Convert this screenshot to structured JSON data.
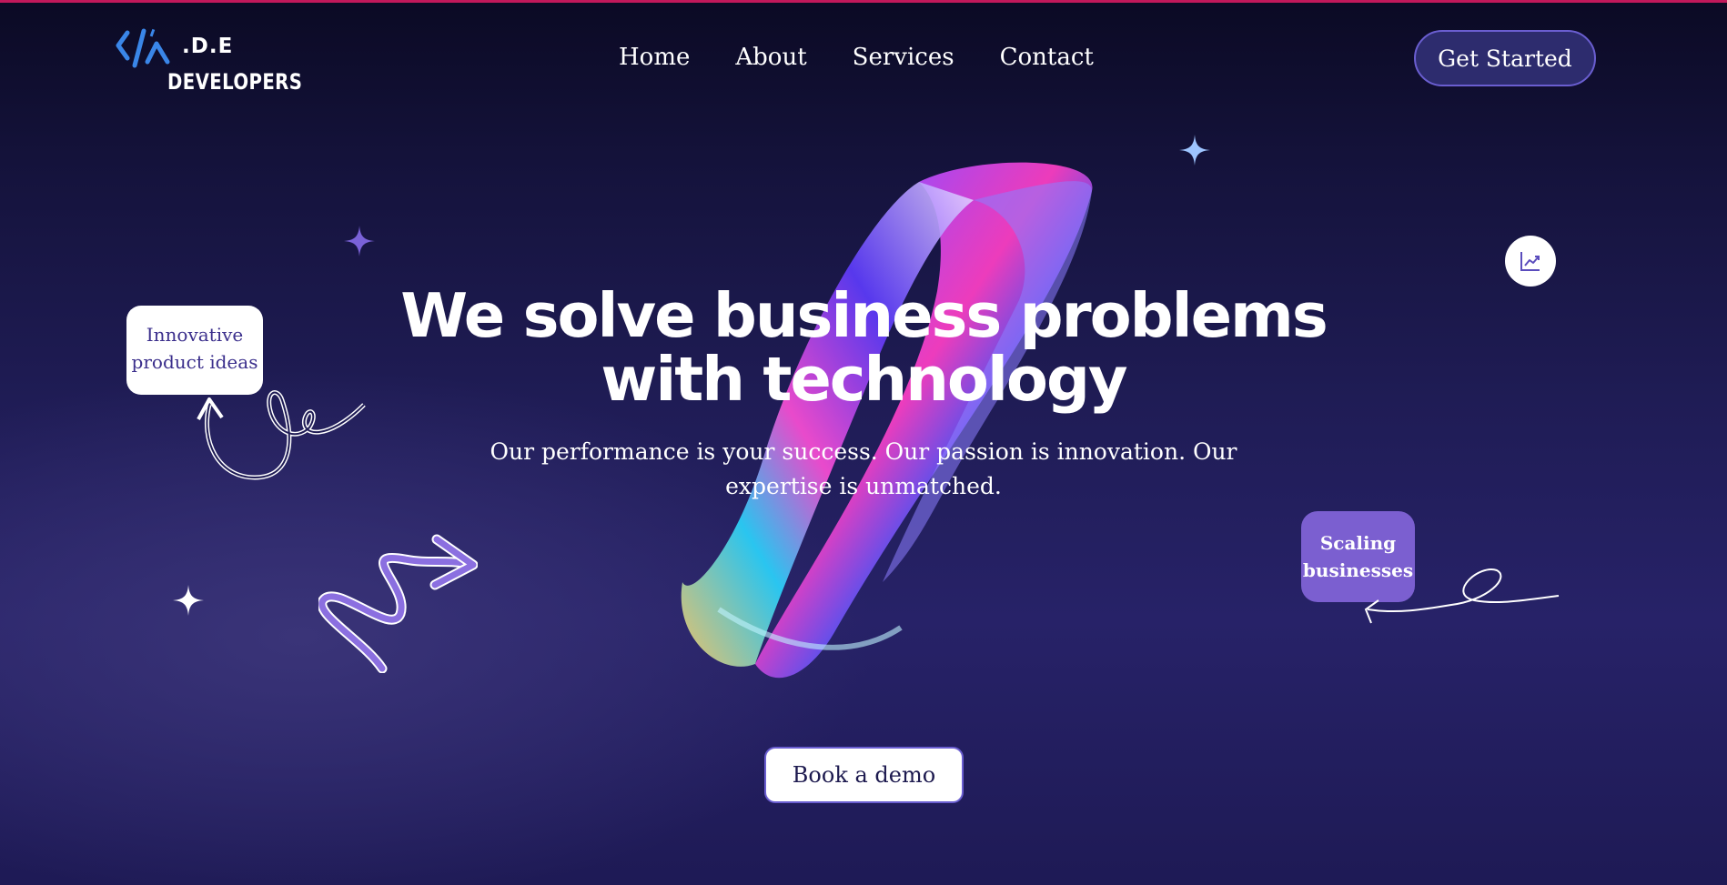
{
  "brand": {
    "logo_suffix": ".D.E",
    "logo_sub": "DEVELOPERS"
  },
  "nav": {
    "items": [
      "Home",
      "About",
      "Services",
      "Contact"
    ],
    "cta_label": "Get Started"
  },
  "hero": {
    "title_line1": "We solve business problems",
    "title_line2": "with technology",
    "subtitle": "Our performance is your success. Our passion is innovation. Our expertise is unmatched.",
    "cta_label": "Book a demo"
  },
  "tags": {
    "innovative_line1": "Innovative",
    "innovative_line2": "product ideas",
    "scaling_line1": "Scaling",
    "scaling_line2": "businesses"
  },
  "colors": {
    "accent": "#6a5ed0",
    "tag_purple": "#7b5fd0",
    "top_line": "#c2185b"
  }
}
